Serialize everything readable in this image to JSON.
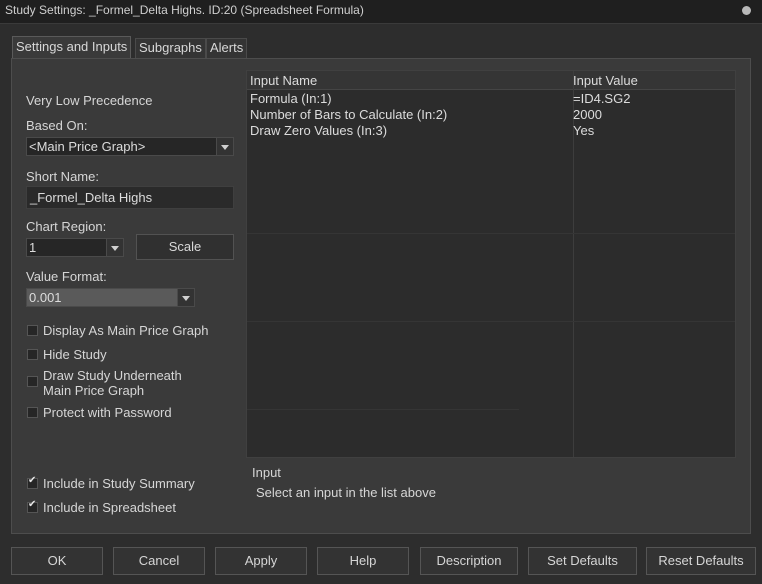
{
  "window": {
    "title": "Study Settings: _Formel_Delta Highs. ID:20 (Spreadsheet Formula)"
  },
  "tabs": [
    {
      "label": "Settings and Inputs",
      "active": true
    },
    {
      "label": "Subgraphs",
      "active": false
    },
    {
      "label": "Alerts",
      "active": false
    }
  ],
  "settings": {
    "precedence": "Very Low Precedence",
    "based_on_label": "Based On:",
    "based_on_value": "<Main Price Graph>",
    "short_name_label": "Short Name:",
    "short_name_value": "_Formel_Delta Highs",
    "chart_region_label": "Chart Region:",
    "chart_region_value": "1",
    "scale_label": "Scale",
    "value_format_label": "Value Format:",
    "value_format_value": "0.001"
  },
  "checkboxes": [
    {
      "label": "Display As Main Price Graph",
      "checked": false
    },
    {
      "label": "Hide Study",
      "checked": false
    },
    {
      "label": "Draw Study Underneath\nMain Price Graph",
      "label_line1": "Draw Study Underneath",
      "label_line2": "Main Price Graph",
      "checked": false
    },
    {
      "label": "Protect with Password",
      "checked": false
    },
    {
      "label": "Include in Study Summary",
      "checked": true
    },
    {
      "label": "Include in Spreadsheet",
      "checked": true
    }
  ],
  "inputs_table": {
    "columns": [
      "Input Name",
      "Input Value"
    ],
    "rows": [
      {
        "name": "Formula   (In:1)",
        "value": "=ID4.SG2"
      },
      {
        "name": "Number of Bars to Calculate   (In:2)",
        "value": "2000"
      },
      {
        "name": "Draw Zero Values   (In:3)",
        "value": "Yes"
      }
    ]
  },
  "input_info": {
    "heading": "Input",
    "description": "Select an input in the list above"
  },
  "footer_buttons": [
    "OK",
    "Cancel",
    "Apply",
    "Help",
    "Description",
    "Set Defaults",
    "Reset Defaults"
  ],
  "colors": {
    "background": "#2d2d2d",
    "panel": "#3a3a3a",
    "titlebar": "#1f1f1f"
  }
}
